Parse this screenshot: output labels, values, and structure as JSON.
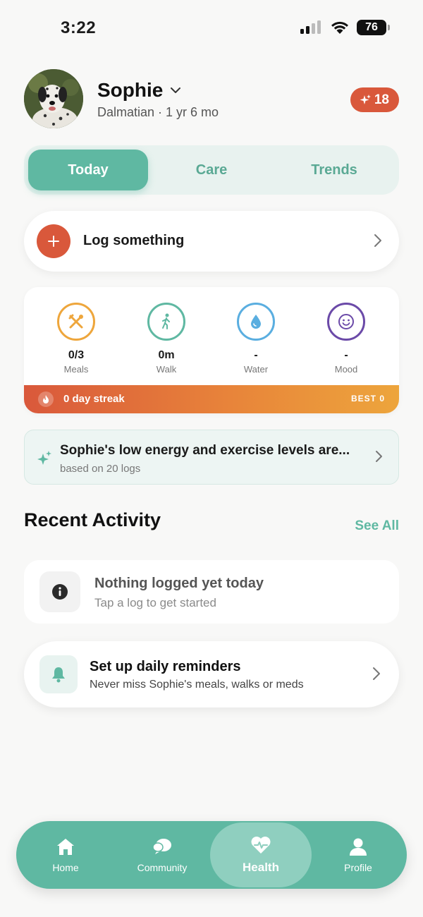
{
  "status_bar": {
    "time": "3:22",
    "battery": "76"
  },
  "pet": {
    "name": "Sophie",
    "subtitle": "Dalmatian · 1 yr 6 mo",
    "points": "18"
  },
  "tabs": [
    {
      "label": "Today",
      "active": true
    },
    {
      "label": "Care",
      "active": false
    },
    {
      "label": "Trends",
      "active": false
    }
  ],
  "log": {
    "label": "Log something"
  },
  "metrics": [
    {
      "value": "0/3",
      "label": "Meals",
      "icon": "fork-knife-icon",
      "color": "#eea63c"
    },
    {
      "value": "0m",
      "label": "Walk",
      "icon": "walking-person-icon",
      "color": "#5fb8a2"
    },
    {
      "value": "-",
      "label": "Water",
      "icon": "water-drop-icon",
      "color": "#5aaee0"
    },
    {
      "value": "-",
      "label": "Mood",
      "icon": "smiley-icon",
      "color": "#6b4aa8"
    }
  ],
  "streak": {
    "text": "0 day streak",
    "best": "BEST 0"
  },
  "insight": {
    "title": "Sophie's low energy and exercise levels are...",
    "subtitle": "based on 20 logs"
  },
  "recent": {
    "title": "Recent Activity",
    "see_all": "See All",
    "empty_title": "Nothing logged yet today",
    "empty_sub": "Tap a log to get started"
  },
  "reminder": {
    "title": "Set up daily reminders",
    "subtitle": "Never miss Sophie's meals, walks or meds"
  },
  "nav": [
    {
      "label": "Home",
      "icon": "home-icon",
      "active": false
    },
    {
      "label": "Community",
      "icon": "chat-bubbles-icon",
      "active": false
    },
    {
      "label": "Health",
      "icon": "heart-pulse-icon",
      "active": true
    },
    {
      "label": "Profile",
      "icon": "person-icon",
      "active": false
    }
  ],
  "colors": {
    "accent": "#5fb8a2",
    "brand_red": "#d9583b",
    "background": "#f8f8f7"
  }
}
